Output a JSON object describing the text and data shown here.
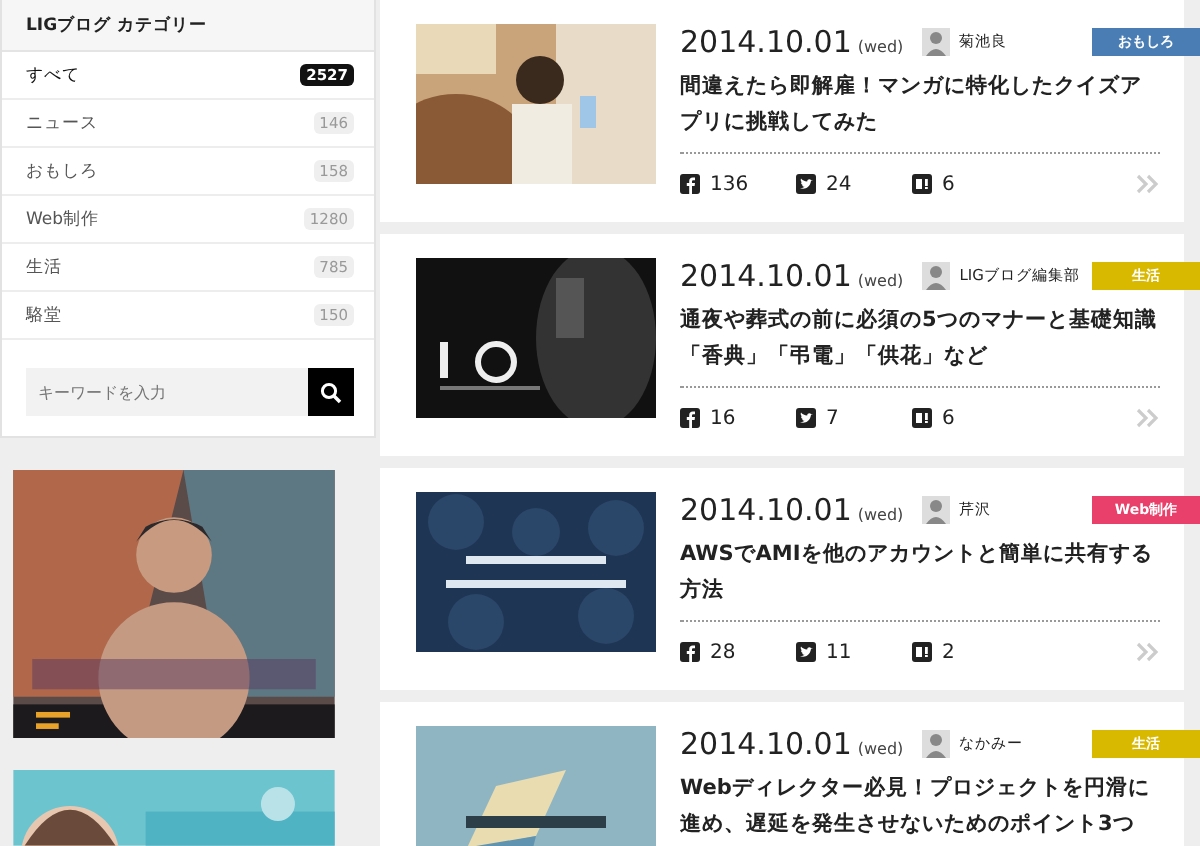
{
  "sidebar": {
    "title": "LIGブログ カテゴリー",
    "categories": [
      {
        "label": "すべて",
        "count": "2527",
        "selected": true
      },
      {
        "label": "ニュース",
        "count": "146",
        "selected": false
      },
      {
        "label": "おもしろ",
        "count": "158",
        "selected": false
      },
      {
        "label": "Web制作",
        "count": "1280",
        "selected": false
      },
      {
        "label": "生活",
        "count": "785",
        "selected": false
      },
      {
        "label": "駱堂",
        "count": "150",
        "selected": false
      }
    ],
    "search": {
      "placeholder": "キーワードを入力"
    }
  },
  "articles": [
    {
      "date": "2014.10.01",
      "weekday": "(wed)",
      "author": "菊池良",
      "tag": "おもしろ",
      "color": "#4a7db3",
      "title": "間違えたら即解雇！マンガに特化したクイズアプリに挑戦してみた",
      "facebook": "136",
      "twitter": "24",
      "hatena": "6"
    },
    {
      "date": "2014.10.01",
      "weekday": "(wed)",
      "author": "LIGブログ編集部",
      "tag": "生活",
      "color": "#d9b800",
      "title": "通夜や葬式の前に必須の5つのマナーと基礎知識「香典」「弔電」「供花」など",
      "facebook": "16",
      "twitter": "7",
      "hatena": "6"
    },
    {
      "date": "2014.10.01",
      "weekday": "(wed)",
      "author": "芹沢",
      "tag": "Web制作",
      "color": "#e8406a",
      "title": "AWSでAMIを他のアカウントと簡単に共有する方法",
      "facebook": "28",
      "twitter": "11",
      "hatena": "2"
    },
    {
      "date": "2014.10.01",
      "weekday": "(wed)",
      "author": "なかみー",
      "tag": "生活",
      "color": "#d9b800",
      "title": "Webディレクター必見！プロジェクトを円滑に進め、遅延を発生させないためのポイント3つ"
    }
  ]
}
